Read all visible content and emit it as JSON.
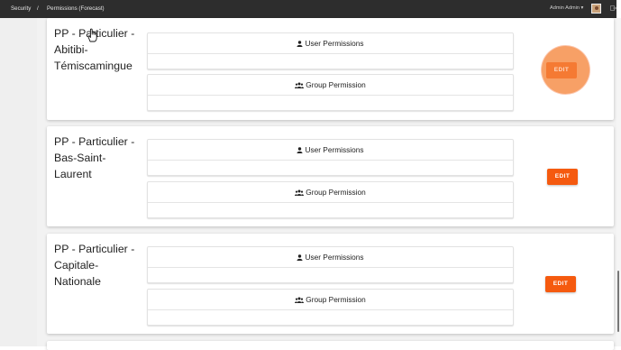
{
  "breadcrumb": {
    "root": "Security",
    "separator": "/",
    "current": "Permissions (Forecast)"
  },
  "header": {
    "user_label": "Admin Admin ▾"
  },
  "cards": [
    {
      "title": "PP - Particulier - Abitibi-Témiscamingue",
      "user_permissions_label": "User Permissions",
      "group_permission_label": "Group Permission",
      "edit_label": "EDIT"
    },
    {
      "title": "PP - Particulier - Bas-Saint-Laurent",
      "user_permissions_label": "User Permissions",
      "group_permission_label": "Group Permission",
      "edit_label": "EDIT"
    },
    {
      "title": "PP - Particulier - Capitale-Nationale",
      "user_permissions_label": "User Permissions",
      "group_permission_label": "Group Permission",
      "edit_label": "EDIT"
    }
  ],
  "colors": {
    "accent": "#f55a0f",
    "topbar": "#2d2d2d"
  },
  "icons": [
    "user-icon",
    "users-icon",
    "logout-icon",
    "hand-cursor-icon"
  ]
}
